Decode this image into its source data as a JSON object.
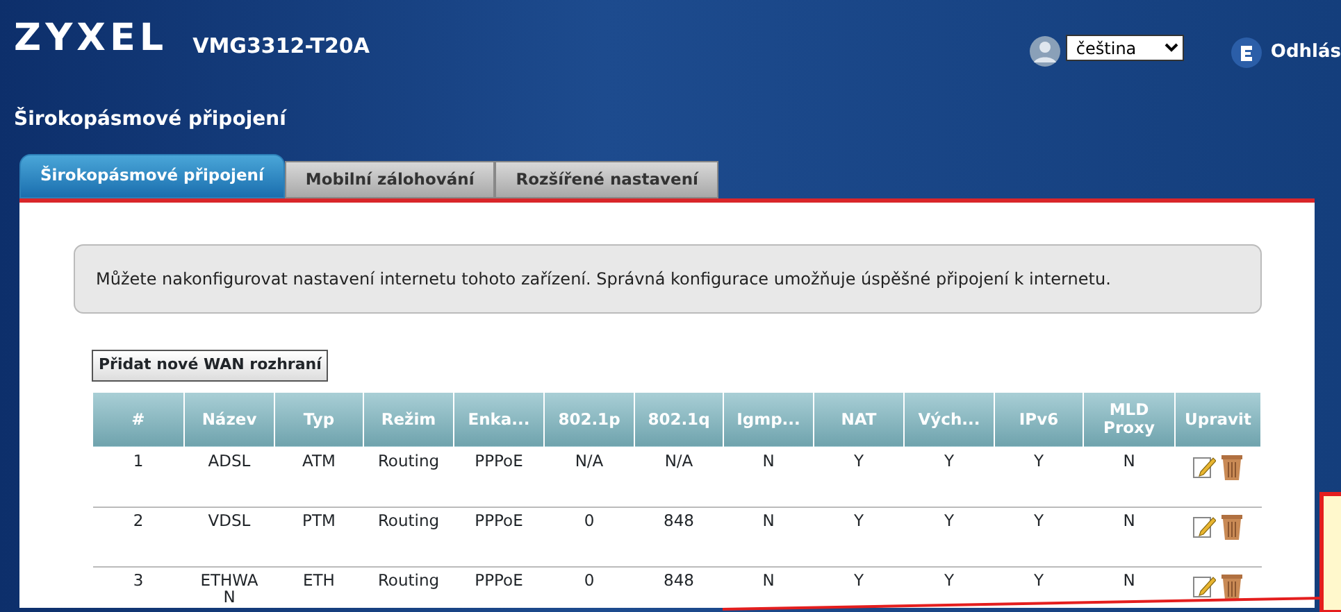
{
  "header": {
    "logo": "ZYXEL",
    "model": "VMG3312-T20A",
    "language": "čeština",
    "logout": "Odhlás"
  },
  "page_title": "Širokopásmové připojení",
  "tabs": [
    {
      "label": "Širokopásmové připojení",
      "selected": true
    },
    {
      "label": "Mobilní zálohování",
      "selected": false
    },
    {
      "label": "Rozšířené nastavení",
      "selected": false
    }
  ],
  "info": "Můžete nakonfigurovat nastavení internetu tohoto zařízení. Správná konfigurace umožňuje úspěšné připojení k internetu.",
  "add_button": "Přidat nové WAN rozhraní",
  "table": {
    "columns": [
      "#",
      "Název",
      "Typ",
      "Režim",
      "Enka...",
      "802.1p",
      "802.1q",
      "Igmp...",
      "NAT",
      "Vých...",
      "IPv6",
      "MLD Proxy",
      "Upravit"
    ],
    "rows": [
      {
        "cells": [
          "1",
          "ADSL",
          "ATM",
          "Routing",
          "PPPoE",
          "N/A",
          "N/A",
          "N",
          "Y",
          "Y",
          "Y",
          "N"
        ]
      },
      {
        "cells": [
          "2",
          "VDSL",
          "PTM",
          "Routing",
          "PPPoE",
          "0",
          "848",
          "N",
          "Y",
          "Y",
          "Y",
          "N"
        ]
      },
      {
        "cells": [
          "3",
          "ETHWAN",
          "ETH",
          "Routing",
          "PPPoE",
          "0",
          "848",
          "N",
          "Y",
          "Y",
          "Y",
          "N"
        ]
      }
    ]
  }
}
